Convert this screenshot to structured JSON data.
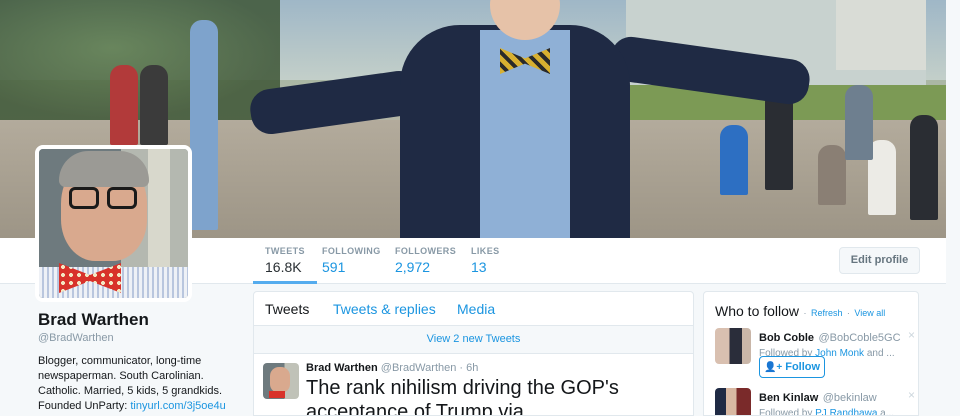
{
  "profile": {
    "name": "Brad Warthen",
    "handle": "@BradWarthen",
    "bio_lines": [
      "Blogger, communicator, long-time",
      "newspaperman. South Carolinian.",
      "Catholic. Married, 5 kids, 5 grandkids."
    ],
    "founded_prefix": "Founded UnParty: ",
    "founded_link": "tinyurl.com/3j5oe4u"
  },
  "nav": {
    "tweets": {
      "label": "TWEETS",
      "value": "16.8K"
    },
    "following": {
      "label": "FOLLOWING",
      "value": "591"
    },
    "followers": {
      "label": "FOLLOWERS",
      "value": "2,972"
    },
    "likes": {
      "label": "LIKES",
      "value": "13"
    },
    "edit_profile": "Edit profile"
  },
  "timeline": {
    "tabs": [
      "Tweets",
      "Tweets & replies",
      "Media"
    ],
    "new_tweets": "View 2 new Tweets",
    "tweet": {
      "name": "Brad Warthen",
      "handle": "@BradWarthen",
      "sep": "·",
      "time": "6h",
      "text": "The rank nihilism driving the GOP's acceptance of Trump via"
    }
  },
  "who_to_follow": {
    "title": "Who to follow",
    "sep": "·",
    "refresh": "Refresh",
    "view_all": "View all",
    "follow_label": "Follow",
    "close_glyph": "×",
    "suggestions": [
      {
        "name": "Bob Coble",
        "handle": "@BobCoble5GC",
        "followed_prefix": "Followed by ",
        "followed_by": "John Monk",
        "followed_suffix": " and ..."
      },
      {
        "name": "Ben Kinlaw",
        "handle": "@bekinlaw",
        "followed_prefix": "Followed by ",
        "followed_by": "PJ Randhawa",
        "followed_suffix": " a..."
      }
    ]
  },
  "colors": {
    "accent": "#1b95e0",
    "nav_active_underline": "#55acee",
    "text": "#14171a",
    "muted": "#8899a6"
  }
}
